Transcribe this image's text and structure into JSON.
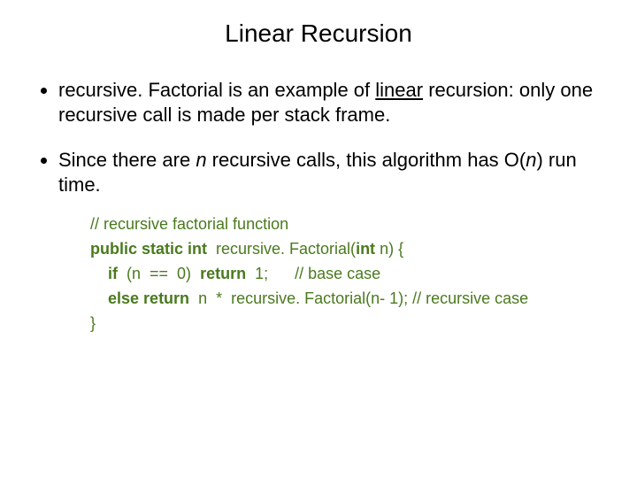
{
  "title": "Linear Recursion",
  "bullets": {
    "b1": {
      "pre": "recursive. Factorial is an example of ",
      "linear": "linear",
      "post": " recursion: only one recursive call is made per stack frame."
    },
    "b2": {
      "pre": "Since there are ",
      "n1": "n",
      "mid": " recursive calls, this algorithm has O(",
      "n2": "n",
      "post": ") run time."
    }
  },
  "code": {
    "l1": "// recursive factorial function",
    "l2a": "public static int",
    "l2b": "  recursive. Factorial(",
    "l2c": "int",
    "l2d": " n) {",
    "l3a": "    ",
    "l3b": "if",
    "l3c": "  (n  ==  0)  ",
    "l3d": "return",
    "l3e": "  1;      // base case",
    "l4a": "    ",
    "l4b": "else return",
    "l4c": "  n  *  recursive. Factorial(n- 1); // recursive case",
    "l5": "}"
  }
}
